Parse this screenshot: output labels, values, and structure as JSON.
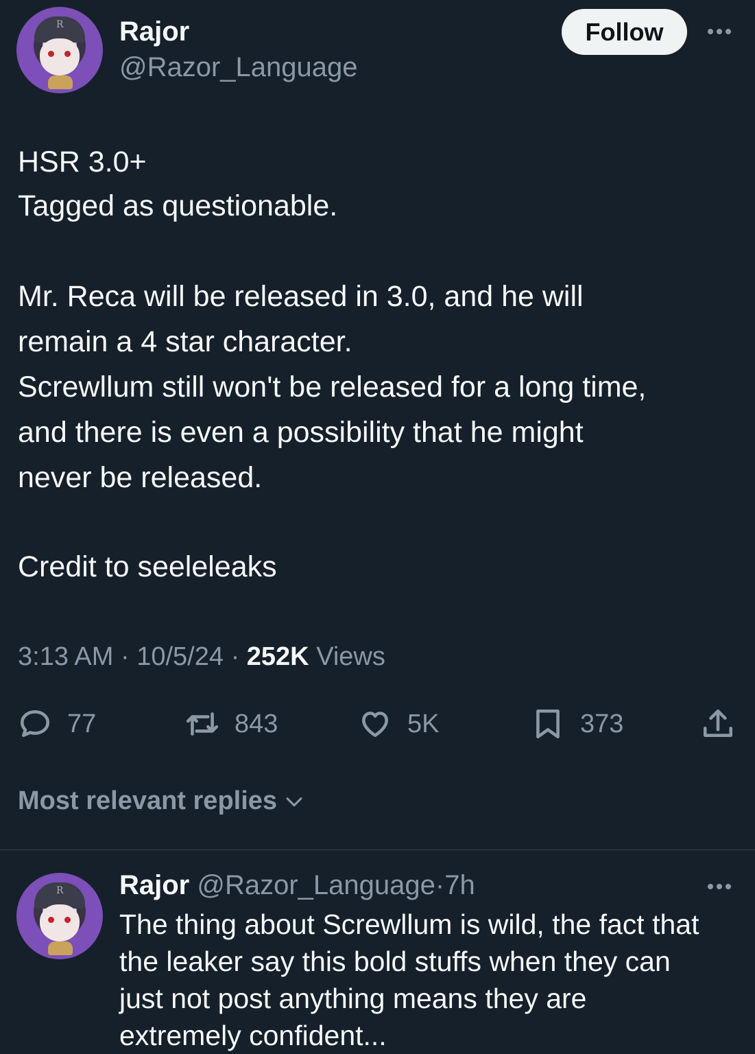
{
  "tweet": {
    "author_name": "Rajor",
    "author_handle": "@Razor_Language",
    "follow_label": "Follow",
    "body_lines": [
      "HSR 3.0+",
      "Tagged as questionable.",
      "Mr. Reca will be released in 3.0, and he will",
      "remain a 4 star character.",
      "Screwllum still won't be released for a long time,",
      "and there is even a possibility that he might",
      "never be released.",
      "Credit to seeleleaks"
    ],
    "time": "3:13 AM",
    "date": "10/5/24",
    "views_count": "252K",
    "views_label": "Views",
    "separator": "·"
  },
  "actions": {
    "replies": "77",
    "retweets": "843",
    "likes": "5K",
    "bookmarks": "373"
  },
  "replies_section": {
    "sort_label": "Most relevant replies"
  },
  "reply": {
    "author_name": "Rajor",
    "author_handle": "@Razor_Language",
    "age": "7h",
    "separator": "·",
    "body_lines": [
      "The thing about Screwllum is wild, the fact that",
      "the leaker say this bold stuffs when they can",
      "just not post anything means they are",
      "extremely confident..."
    ]
  },
  "icons": {
    "reply": "speech-bubble-icon",
    "retweet": "retweet-icon",
    "like": "heart-icon",
    "bookmark": "bookmark-icon",
    "share": "share-upload-icon",
    "more": "more-horizontal-icon",
    "chevron": "chevron-down-icon"
  },
  "colors": {
    "background": "#15202b",
    "text_primary": "#f7f9f9",
    "text_secondary": "#8b98a5",
    "follow_bg": "#eff3f4",
    "divider": "#38444d"
  }
}
